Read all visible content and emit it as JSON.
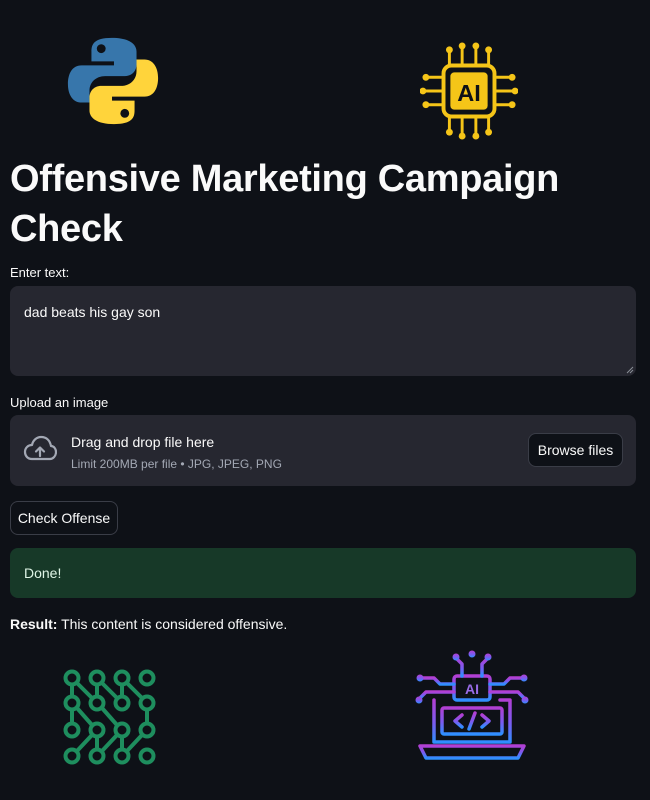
{
  "app": {
    "title": "Offensive Marketing Campaign Check"
  },
  "logos": {
    "chip_text": "AI",
    "laptop_text": "AI",
    "colors": {
      "python_blue": "#3776ab",
      "python_yellow": "#ffd43b",
      "chip_yellow": "#f5c518",
      "network_green": "#1e8e5e"
    }
  },
  "text_input": {
    "label": "Enter text:",
    "value": "dad beats his gay son"
  },
  "uploader": {
    "label": "Upload an image",
    "drop_title": "Drag and drop file here",
    "limit": "Limit 200MB per file • JPG, JPEG, PNG",
    "browse_label": "Browse files",
    "icon": "cloud-upload-icon"
  },
  "check_button": {
    "label": "Check Offense"
  },
  "status": {
    "message": "Done!",
    "color": "#173928"
  },
  "result": {
    "label": "Result:",
    "text": "This content is considered offensive."
  }
}
